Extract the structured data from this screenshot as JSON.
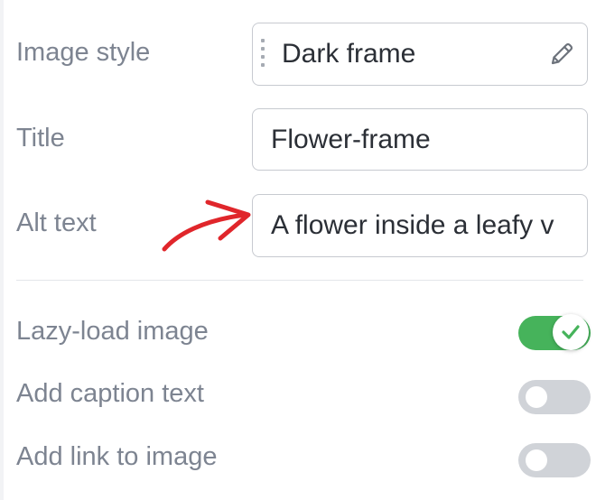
{
  "settings": {
    "image_style": {
      "label": "Image style",
      "value": "Dark frame",
      "edit_icon": "pencil-icon",
      "handle_icon": "drag-handle-icon"
    },
    "title": {
      "label": "Title",
      "value": "Flower-frame"
    },
    "alt_text": {
      "label": "Alt text",
      "value": "A flower inside a leafy v"
    },
    "lazy_load": {
      "label": "Lazy-load image",
      "on": true
    },
    "caption": {
      "label": "Add caption text",
      "on": false
    },
    "link": {
      "label": "Add link to image",
      "on": false
    }
  },
  "colors": {
    "label": "#7d8491",
    "toggle_on": "#46b35b",
    "toggle_off": "#d0d3d8",
    "annotation_arrow": "#e0262b"
  },
  "annotation": {
    "icon": "red-arrow-icon"
  }
}
